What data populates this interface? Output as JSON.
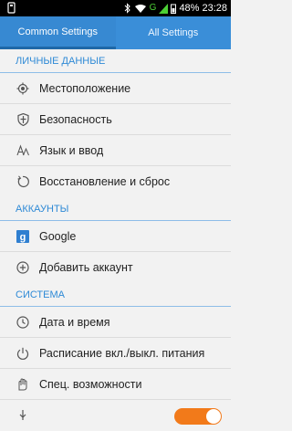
{
  "status_bar": {
    "battery_percent": "48%",
    "time": "23:28",
    "signal_label": "G"
  },
  "tabs": [
    {
      "label": "Common Settings",
      "active": true
    },
    {
      "label": "All Settings",
      "active": false
    }
  ],
  "sections": [
    {
      "header": "ЛИЧНЫЕ ДАННЫЕ",
      "items": [
        {
          "label": "Местоположение",
          "icon": "location-icon"
        },
        {
          "label": "Безопасность",
          "icon": "shield-icon"
        },
        {
          "label": "Язык и ввод",
          "icon": "language-icon"
        },
        {
          "label": "Восстановление и сброс",
          "icon": "restore-icon"
        }
      ]
    },
    {
      "header": "АККАУНТЫ",
      "items": [
        {
          "label": "Google",
          "icon": "google-icon"
        },
        {
          "label": "Добавить аккаунт",
          "icon": "add-account-icon"
        }
      ]
    },
    {
      "header": "СИСТЕМА",
      "items": [
        {
          "label": "Дата и время",
          "icon": "clock-icon"
        },
        {
          "label": "Расписание вкл./выкл. питания",
          "icon": "power-schedule-icon"
        },
        {
          "label": "Спец. возможности",
          "icon": "accessibility-icon"
        }
      ]
    }
  ],
  "colors": {
    "accent": "#3a8ed8",
    "section_header": "#2f8ad6",
    "toggle_on": "#f27a1a"
  }
}
